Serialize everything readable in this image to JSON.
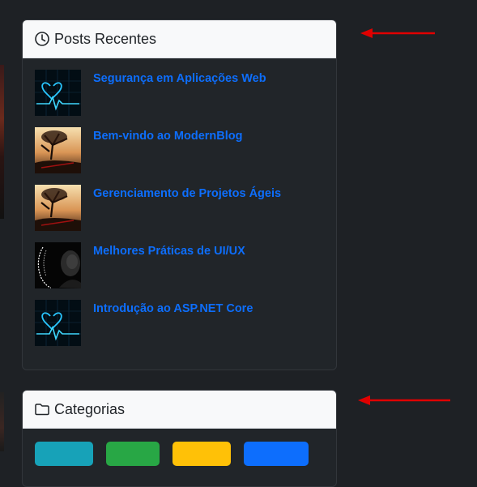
{
  "recent_posts": {
    "title": "Posts Recentes",
    "header_icon": "clock-icon",
    "posts": [
      {
        "title": "Segurança em Aplicações Web",
        "thumb": "heartbeat-neon"
      },
      {
        "title": "Bem-vindo ao ModernBlog",
        "thumb": "sunset-tree"
      },
      {
        "title": "Gerenciamento de Projetos Ágeis",
        "thumb": "sunset-tree"
      },
      {
        "title": "Melhores Práticas de UI/UX",
        "thumb": "face-sketch"
      },
      {
        "title": "Introdução ao ASP.NET Core",
        "thumb": "heartbeat-neon"
      }
    ]
  },
  "categories": {
    "title": "Categorias",
    "header_icon": "folder-icon",
    "badge_colors": [
      "#17a2b8",
      "#28a745",
      "#ffc107",
      "#0d6efd"
    ]
  },
  "colors": {
    "link": "#0d6efd",
    "card_bg": "#212529",
    "page_bg": "#1e2125",
    "header_bg": "#f8f9fa",
    "annotation_arrow": "#e00000"
  }
}
